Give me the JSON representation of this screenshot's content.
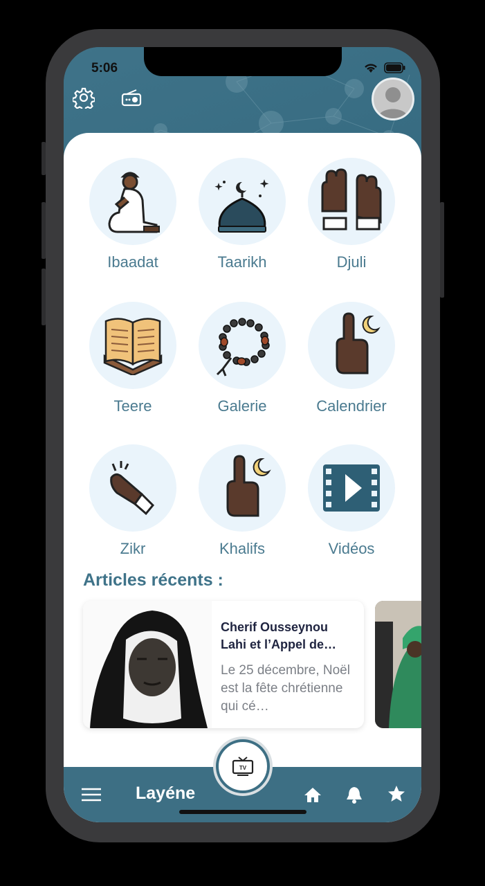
{
  "status_bar": {
    "time": "5:06"
  },
  "header": {
    "settings_icon": "gear-icon",
    "radio_icon": "radio-icon",
    "avatar_icon": "user-avatar"
  },
  "grid": {
    "items": [
      {
        "label": "Ibaadat",
        "icon": "praying-man-icon"
      },
      {
        "label": "Taarikh",
        "icon": "mosque-dome-icon"
      },
      {
        "label": "Djuli",
        "icon": "praying-hands-icon"
      },
      {
        "label": "Teere",
        "icon": "open-quran-icon"
      },
      {
        "label": "Galerie",
        "icon": "prayer-beads-icon"
      },
      {
        "label": "Calendrier",
        "icon": "hand-moon-icon"
      },
      {
        "label": "Zikr",
        "icon": "snapping-hand-icon"
      },
      {
        "label": "Khalifs",
        "icon": "hand-moon-icon"
      },
      {
        "label": "Vidéos",
        "icon": "video-play-icon"
      }
    ]
  },
  "articles": {
    "section_title": "Articles récents :",
    "items": [
      {
        "title": "Cherif Ousseynou Lahi et l’Appel de…",
        "excerpt": "Le 25 décembre, Noël est la fête chrétienne qui cé…"
      }
    ]
  },
  "tabbar": {
    "title": "Layéne",
    "tv_label": "TV",
    "menu_icon": "hamburger-icon",
    "home_icon": "home-icon",
    "bell_icon": "bell-icon",
    "star_icon": "star-icon"
  },
  "colors": {
    "primary": "#3d6f84",
    "accent_text": "#4a7a8f",
    "circle_bg": "#eaf4fb",
    "title_dark": "#1f2440"
  }
}
